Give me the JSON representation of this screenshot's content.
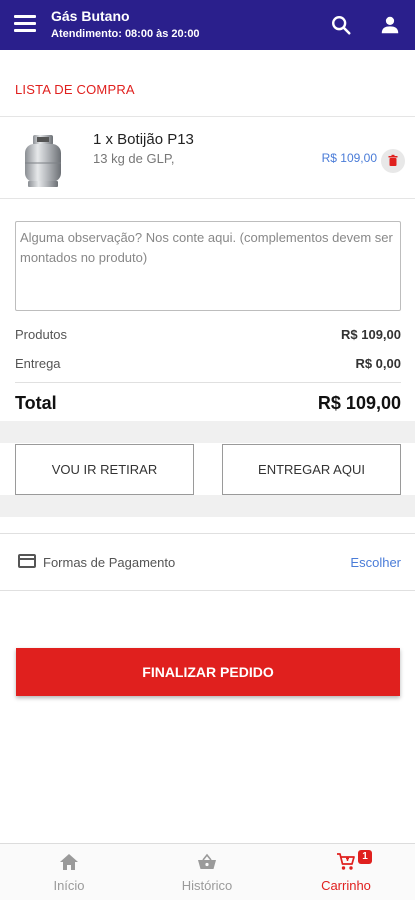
{
  "app": {
    "title": "Gás Butano",
    "subtitle": "Atendimento: 08:00 às 20:00"
  },
  "cart": {
    "section_title": "LISTA DE COMPRA",
    "items": [
      {
        "name": "1 x Botijão P13",
        "description": "13 kg de GLP,",
        "price": "R$ 109,00"
      }
    ],
    "observation_placeholder": "Alguma observação? Nos conte aqui. (complementos devem ser montados no produto)"
  },
  "summary": {
    "products_label": "Produtos",
    "products_value": "R$ 109,00",
    "delivery_label": "Entrega",
    "delivery_value": "R$ 0,00",
    "total_label": "Total",
    "total_value": "R$ 109,00"
  },
  "delivery_options": {
    "pickup_label": "VOU IR RETIRAR",
    "deliver_label": "ENTREGAR AQUI"
  },
  "payment": {
    "label": "Formas de Pagamento",
    "action": "Escolher"
  },
  "finalize_label": "FINALIZAR PEDIDO",
  "bottom_nav": {
    "items": [
      {
        "label": "Início",
        "icon": "home-icon"
      },
      {
        "label": "Histórico",
        "icon": "basket-icon"
      },
      {
        "label": "Carrinho",
        "icon": "cart-icon",
        "badge": "1"
      }
    ]
  },
  "colors": {
    "header": "#2a1f8c",
    "accent_red": "#e0201e",
    "link_blue": "#4a7cd8"
  }
}
